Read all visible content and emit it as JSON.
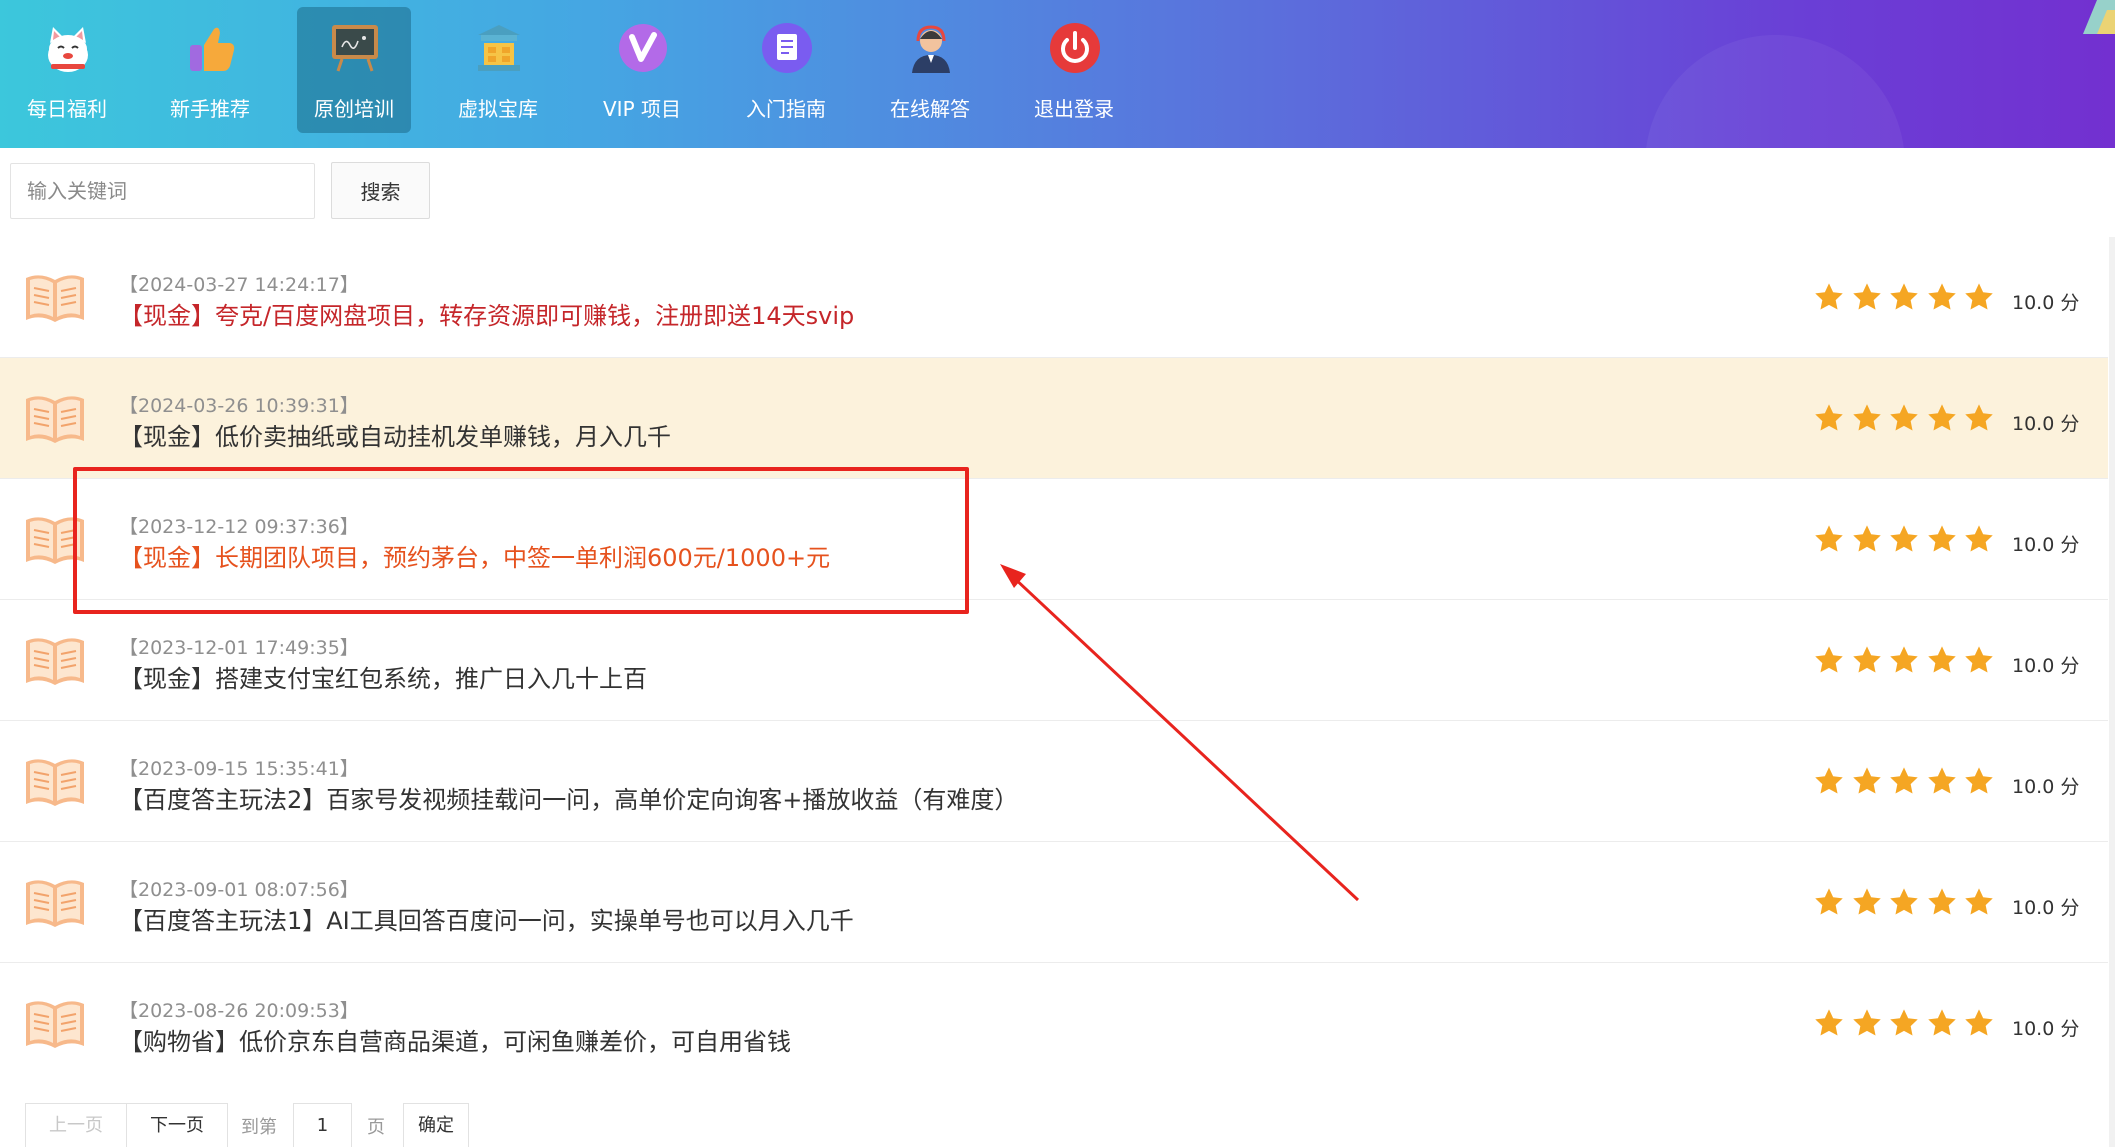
{
  "nav": {
    "items": [
      {
        "label": "每日福利",
        "icon": "lucky-cat-icon",
        "active": false
      },
      {
        "label": "新手推荐",
        "icon": "thumbs-up-icon",
        "active": false
      },
      {
        "label": "原创培训",
        "icon": "blackboard-icon",
        "active": true
      },
      {
        "label": "虚拟宝库",
        "icon": "treasure-bank-icon",
        "active": false
      },
      {
        "label": "VIP 项目",
        "icon": "vip-badge-icon",
        "active": false
      },
      {
        "label": "入门指南",
        "icon": "document-icon",
        "active": false
      },
      {
        "label": "在线解答",
        "icon": "support-agent-icon",
        "active": false
      },
      {
        "label": "退出登录",
        "icon": "power-icon",
        "active": false
      }
    ]
  },
  "search": {
    "placeholder": "输入关键词",
    "button_label": "搜索"
  },
  "articles": [
    {
      "date": "【2024-03-27 14:24:17】",
      "title": "【现金】夸克/百度网盘项目，转存资源即可赚钱，注册即送14天svip",
      "title_color": "red",
      "stars": 5,
      "score": "10.0 分",
      "highlighted": false
    },
    {
      "date": "【2024-03-26 10:39:31】",
      "title": "【现金】低价卖抽纸或自动挂机发单赚钱，月入几千",
      "title_color": "default",
      "stars": 5,
      "score": "10.0 分",
      "highlighted": true
    },
    {
      "date": "【2023-12-12 09:37:36】",
      "title": "【现金】长期团队项目，预约茅台，中签一单利润600元/1000+元",
      "title_color": "orange",
      "stars": 5,
      "score": "10.0 分",
      "highlighted": false
    },
    {
      "date": "【2023-12-01 17:49:35】",
      "title": "【现金】搭建支付宝红包系统，推广日入几十上百",
      "title_color": "default",
      "stars": 5,
      "score": "10.0 分",
      "highlighted": false
    },
    {
      "date": "【2023-09-15 15:35:41】",
      "title": "【百度答主玩法2】百家号发视频挂载问一问，高单价定向询客+播放收益（有难度）",
      "title_color": "default",
      "stars": 5,
      "score": "10.0 分",
      "highlighted": false
    },
    {
      "date": "【2023-09-01 08:07:56】",
      "title": "【百度答主玩法1】AI工具回答百度问一问，实操单号也可以月入几千",
      "title_color": "default",
      "stars": 5,
      "score": "10.0 分",
      "highlighted": false
    },
    {
      "date": "【2023-08-26 20:09:53】",
      "title": "【购物省】低价京东自营商品渠道，可闲鱼赚差价，可自用省钱",
      "title_color": "default",
      "stars": 5,
      "score": "10.0 分",
      "highlighted": false
    }
  ],
  "pagination": {
    "prev_label": "上一页",
    "next_label": "下一页",
    "goto_label": "到第",
    "page_value": "1",
    "page_unit": "页",
    "confirm_label": "确定"
  },
  "colors": {
    "title_red": "#c5262a",
    "title_orange": "#e6521e",
    "highlight_row": "#fcf2dc",
    "star": "#f5a623",
    "annotation": "#e8241e"
  }
}
